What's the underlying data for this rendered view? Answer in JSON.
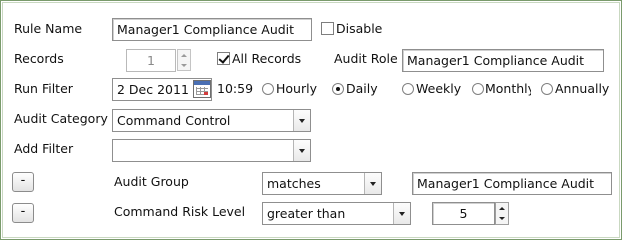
{
  "form": {
    "rule_name": {
      "label": "Rule Name",
      "value": "Manager1 Compliance Audit"
    },
    "disable": {
      "label": "Disable",
      "checked": false
    },
    "records": {
      "label": "Records",
      "value": "1"
    },
    "all_records": {
      "label": "All Records",
      "checked": true
    },
    "audit_role": {
      "label": "Audit Role",
      "value": "Manager1 Compliance Audit"
    },
    "run_filter": {
      "label": "Run Filter",
      "date": "2 Dec 2011",
      "time": "10:59",
      "options": [
        {
          "label": "Hourly",
          "checked": false
        },
        {
          "label": "Daily",
          "checked": true
        },
        {
          "label": "Weekly",
          "checked": false
        },
        {
          "label": "Monthly",
          "checked": false
        },
        {
          "label": "Annually",
          "checked": false
        }
      ]
    },
    "audit_category": {
      "label": "Audit Category",
      "value": "Command Control"
    },
    "add_filter": {
      "label": "Add Filter",
      "value": ""
    },
    "filters": [
      {
        "remove_label": "-",
        "field": "Audit Group",
        "operator": "matches",
        "value": "Manager1 Compliance Audit"
      },
      {
        "remove_label": "-",
        "field": "Command Risk Level",
        "operator": "greater than",
        "value": "5"
      }
    ]
  },
  "icons": {
    "calendar": "calendar-icon",
    "dropdown": "chevron-down-icon",
    "spin": "spinner-arrows-icon"
  },
  "colors": {
    "border_frame": "#7a9a6c",
    "calendar_accent": "#4a6fb3"
  }
}
